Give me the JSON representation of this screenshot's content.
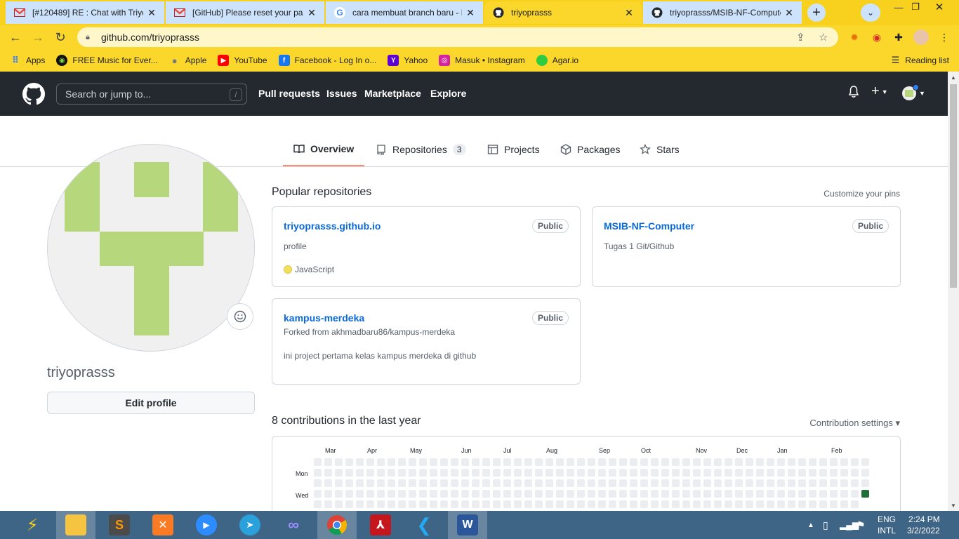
{
  "browser": {
    "tabs": [
      {
        "title": "[#120489] RE : Chat with Triyo",
        "icon": "gmail-icon",
        "active": false
      },
      {
        "title": "[GitHub] Please reset your pass",
        "icon": "gmail-icon",
        "active": false
      },
      {
        "title": "cara membuat branch baru - P",
        "icon": "google-icon",
        "active": false
      },
      {
        "title": "triyoprasss",
        "icon": "github-icon",
        "active": true
      },
      {
        "title": "triyoprasss/MSIB-NF-Compute",
        "icon": "github-icon",
        "active": false
      }
    ],
    "url": "github.com/triyoprasss",
    "bookmarks": [
      {
        "label": "Apps",
        "icon": "apps-grid-icon",
        "color": "#4285f4"
      },
      {
        "label": "FREE Music for Ever...",
        "icon": "music-icon",
        "color": "#111111"
      },
      {
        "label": "Apple",
        "icon": "apple-icon",
        "color": "#777777"
      },
      {
        "label": "YouTube",
        "icon": "youtube-icon",
        "color": "#ff0000"
      },
      {
        "label": "Facebook - Log In o...",
        "icon": "facebook-icon",
        "color": "#1877f2"
      },
      {
        "label": "Yahoo",
        "icon": "yahoo-icon",
        "color": "#5f01d1"
      },
      {
        "label": "Masuk • Instagram",
        "icon": "instagram-icon",
        "color": "#d6249f"
      },
      {
        "label": "Agar.io",
        "icon": "agario-icon",
        "color": "#2ecc40"
      }
    ],
    "reading_list": "Reading list"
  },
  "github": {
    "search_placeholder": "Search or jump to...",
    "search_key": "/",
    "nav": [
      "Pull requests",
      "Issues",
      "Marketplace",
      "Explore"
    ],
    "profile_tabs": [
      {
        "label": "Overview",
        "selected": true
      },
      {
        "label": "Repositories",
        "count": "3"
      },
      {
        "label": "Projects"
      },
      {
        "label": "Packages"
      },
      {
        "label": "Stars"
      }
    ],
    "username": "triyoprasss",
    "edit_profile": "Edit profile",
    "popular_title": "Popular repositories",
    "customize_pins": "Customize your pins",
    "repos": [
      {
        "name": "triyoprasss.github.io",
        "visibility": "Public",
        "description": "profile",
        "language": "JavaScript",
        "language_color": "#f1e05a"
      },
      {
        "name": "MSIB-NF-Computer",
        "visibility": "Public",
        "description": "Tugas 1 Git/Github"
      },
      {
        "name": "kampus-merdeka",
        "visibility": "Public",
        "forked_from": "Forked from akhmadbaru86/kampus-merdeka",
        "description": "ini project pertama kelas kampus merdeka di github"
      }
    ],
    "contrib_title": "8 contributions in the last year",
    "contrib_settings": "Contribution settings ▾",
    "months": [
      "Mar",
      "Apr",
      "May",
      "Jun",
      "Jul",
      "Aug",
      "Sep",
      "Oct",
      "Nov",
      "Dec",
      "Jan",
      "Feb"
    ],
    "day_labels": [
      "Mon",
      "Wed"
    ],
    "colors": {
      "accent": "#fd8c73",
      "link": "#0969da",
      "header": "#24292f",
      "empty_cell": "#ebedf0",
      "filled_cell": "#216e39"
    }
  },
  "taskbar": {
    "lang1": "ENG",
    "lang2": "INTL",
    "time": "2:24 PM",
    "date": "3/2/2022"
  }
}
